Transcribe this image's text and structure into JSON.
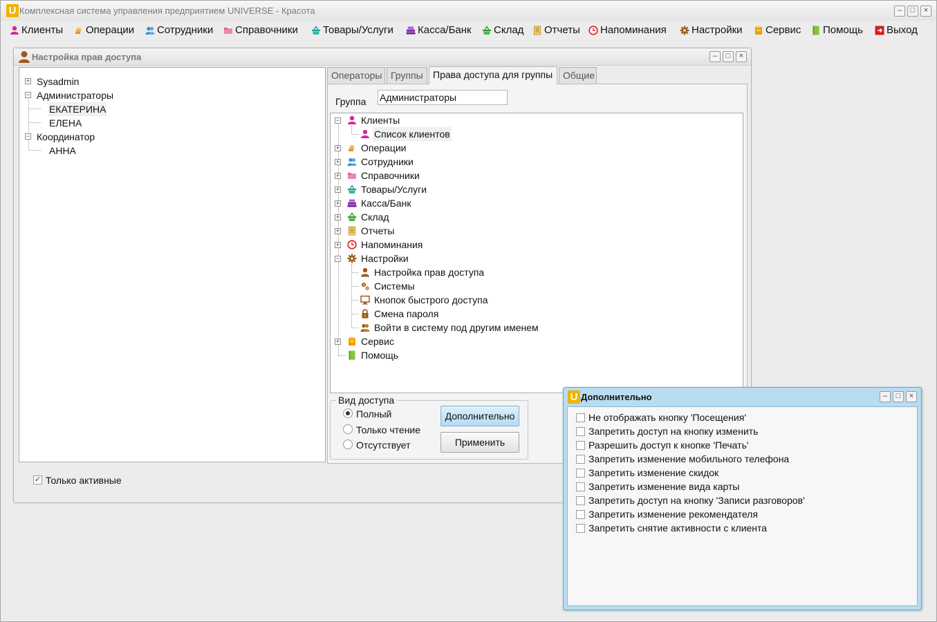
{
  "app": {
    "title": "Комплексная система управления предприятием UNIVERSE - Красота",
    "logo_letter": "U"
  },
  "menu": [
    {
      "label": "Клиенты",
      "icon": "clients-icon",
      "color": "#d6289a"
    },
    {
      "label": "Операции",
      "icon": "coins-icon",
      "color": "#d99a20"
    },
    {
      "label": "Сотрудники",
      "icon": "employees-icon",
      "color": "#2f8fd6"
    },
    {
      "label": "Справочники",
      "icon": "folder-icon",
      "color": "#e0589a"
    },
    {
      "label": "Товары/Услуги",
      "icon": "basket-icon",
      "color": "#1e9e8e"
    },
    {
      "label": "Касса/Банк",
      "icon": "cash-register-icon",
      "color": "#8a2fb8"
    },
    {
      "label": "Склад",
      "icon": "warehouse-basket-icon",
      "color": "#2e9a2e"
    },
    {
      "label": "Отчеты",
      "icon": "report-icon",
      "color": "#d9a22a"
    },
    {
      "label": "Напоминания",
      "icon": "clock-icon",
      "color": "#d42020"
    },
    {
      "label": "Настройки",
      "icon": "gear-icon",
      "color": "#9a5a14"
    },
    {
      "label": "Сервис",
      "icon": "service-icon",
      "color": "#f0a000"
    },
    {
      "label": "Помощь",
      "icon": "help-book-icon",
      "color": "#8ac43a"
    },
    {
      "label": "Выход",
      "icon": "exit-icon",
      "color": "#d81e1e"
    }
  ],
  "rights_window": {
    "title": "Настройка прав доступа",
    "users_tree": [
      {
        "label": "Sysadmin",
        "level": 0,
        "expanded": false
      },
      {
        "label": "Администраторы",
        "level": 0,
        "expanded": true
      },
      {
        "label": "ЕКАТЕРИНА",
        "level": 1,
        "selected": true
      },
      {
        "label": "ЕЛЕНА",
        "level": 1
      },
      {
        "label": "Координатор",
        "level": 0,
        "expanded": true
      },
      {
        "label": "АННА",
        "level": 1
      }
    ],
    "tabs": [
      {
        "label": "Операторы",
        "active": false
      },
      {
        "label": "Группы",
        "active": false
      },
      {
        "label": "Права доступа для группы",
        "active": true
      },
      {
        "label": "Общие",
        "active": false
      }
    ],
    "group_label": "Группа",
    "group_value": "Администраторы",
    "rights_tree": [
      {
        "label": "Клиенты",
        "level": 0,
        "expander": "minus",
        "icon": "clients-icon"
      },
      {
        "label": "Список клиентов",
        "level": 1,
        "icon": "clients-icon",
        "selected": true
      },
      {
        "label": "Операции",
        "level": 0,
        "expander": "plus",
        "icon": "coins-icon"
      },
      {
        "label": "Сотрудники",
        "level": 0,
        "expander": "plus",
        "icon": "employees-icon"
      },
      {
        "label": "Справочники",
        "level": 0,
        "expander": "plus",
        "icon": "folder-icon"
      },
      {
        "label": "Товары/Услуги",
        "level": 0,
        "expander": "plus",
        "icon": "basket-icon"
      },
      {
        "label": "Касса/Банк",
        "level": 0,
        "expander": "plus",
        "icon": "cash-register-icon"
      },
      {
        "label": "Склад",
        "level": 0,
        "expander": "plus",
        "icon": "warehouse-basket-icon"
      },
      {
        "label": "Отчеты",
        "level": 0,
        "expander": "plus",
        "icon": "report-icon"
      },
      {
        "label": "Напоминания",
        "level": 0,
        "expander": "plus",
        "icon": "clock-icon"
      },
      {
        "label": "Настройки",
        "level": 0,
        "expander": "minus",
        "icon": "gear-icon"
      },
      {
        "label": "Настройка прав доступа",
        "level": 1,
        "icon": "user-icon"
      },
      {
        "label": "Системы",
        "level": 1,
        "icon": "gears-icon"
      },
      {
        "label": "Кнопок быстрого доступа",
        "level": 1,
        "icon": "monitor-icon"
      },
      {
        "label": "Смена пароля",
        "level": 1,
        "icon": "lock-icon"
      },
      {
        "label": "Войти в систему под другим именем",
        "level": 1,
        "icon": "users-switch-icon"
      },
      {
        "label": "Сервис",
        "level": 0,
        "expander": "plus",
        "icon": "service-icon"
      },
      {
        "label": "Помощь",
        "level": 0,
        "expander": "none",
        "icon": "help-book-icon"
      }
    ],
    "access_type": {
      "legend": "Вид доступа",
      "options": [
        "Полный",
        "Только чтение",
        "Отсутствует"
      ],
      "selected": "Полный"
    },
    "buttons": {
      "extra": "Дополнительно",
      "apply": "Применить"
    },
    "only_active": {
      "label": "Только активные",
      "checked": true
    }
  },
  "extra_dialog": {
    "title": "Дополнительно",
    "options": [
      {
        "label": "Не отображать кнопку 'Посещения'",
        "checked": false
      },
      {
        "label": "Запретить доступ на кнопку изменить",
        "checked": false
      },
      {
        "label": "Разрешить доступ к кнопке 'Печать'",
        "checked": false
      },
      {
        "label": "Запретить изменение мобильного телефона",
        "checked": false
      },
      {
        "label": "Запретить изменение скидок",
        "checked": false
      },
      {
        "label": "Запретить изменение вида карты",
        "checked": false
      },
      {
        "label": "Запретить доступ на кнопку 'Записи разговоров'",
        "checked": false
      },
      {
        "label": "Запретить изменение рекомендателя",
        "checked": false
      },
      {
        "label": "Запретить снятие активности с клиента",
        "checked": false
      }
    ]
  }
}
